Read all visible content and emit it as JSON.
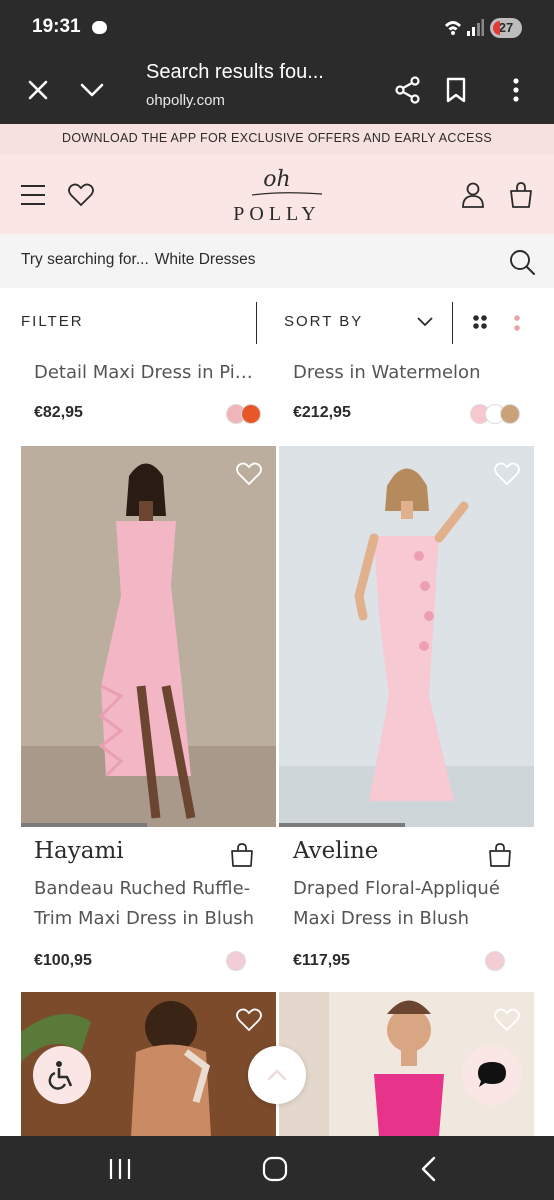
{
  "status": {
    "time": "19:31",
    "battery": "27",
    "icons": [
      "chat-bubble-icon",
      "wifi-icon",
      "signal-icon",
      "battery-icon"
    ]
  },
  "browser": {
    "title": "Search results fou...",
    "url": "ohpolly.com"
  },
  "promo": {
    "text": "DOWNLOAD THE APP FOR EXCLUSIVE OFFERS AND EARLY ACCESS"
  },
  "logo": {
    "oh": "oh",
    "polly": "POLLY"
  },
  "search": {
    "prompt": "Try searching for...",
    "suggestion": "White Dresses"
  },
  "toolbar": {
    "filter": "FILTER",
    "sort": "SORT BY"
  },
  "prev_row": [
    {
      "name": "Detail Maxi Dress in Pin...",
      "price": "€82,95",
      "swatches": [
        "#f0b5b8",
        "#e8572a"
      ]
    },
    {
      "name": "Dress in Watermelon",
      "price": "€212,95",
      "swatches": [
        "#f6c7cd",
        "#ffffff",
        "#c9a27a"
      ]
    }
  ],
  "products": [
    {
      "brand": "Hayami",
      "desc1": "Bandeau Ruched Ruffle-",
      "desc2": "Trim Maxi Dress in Blush",
      "price": "€100,95",
      "swatch": "#f3cdd6"
    },
    {
      "brand": "Aveline",
      "desc1": "Draped Floral-Appliqué",
      "desc2": "Maxi Dress in Blush",
      "price": "€117,95",
      "swatch": "#f3cdd6"
    }
  ],
  "colors": {
    "chrome": "#2b2b2b",
    "promo_bg": "#f7e1df",
    "header_bg": "#fae7e5",
    "accent": "#e8a6a6"
  }
}
